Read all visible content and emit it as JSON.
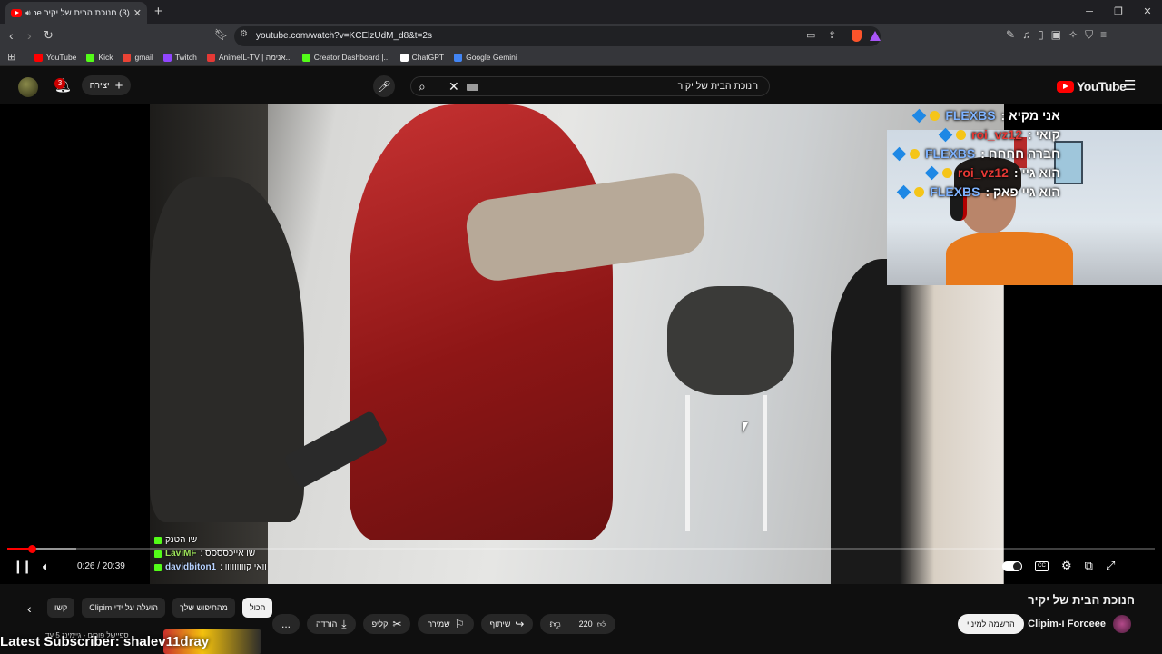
{
  "browser": {
    "tab_title": "(3) חנוכת הבית של יקיר - YouTube",
    "tab_title_short": "(3) חנוכת הבית של יקיר ube",
    "url": "youtube.com/watch?v=KCElzUdM_d8&t=2s",
    "bookmarks": [
      {
        "label": "YouTube",
        "color": "#ff0000"
      },
      {
        "label": "Kick",
        "color": "#53fc18"
      },
      {
        "label": "gmail",
        "color": "#ea4335"
      },
      {
        "label": "Twitch",
        "color": "#9146ff"
      },
      {
        "label": "AnimeIL-TV | אנימה...",
        "color": "#e53935"
      },
      {
        "label": "Creator Dashboard |...",
        "color": "#53fc18"
      },
      {
        "label": "ChatGPT",
        "color": "#ffffff"
      },
      {
        "label": "Google Gemini",
        "color": "#4285f4"
      }
    ]
  },
  "masthead": {
    "notification_count": "3",
    "create_label": "יצירה",
    "search_query": "חנוכת הבית של יקיר",
    "logo_text": "YouTube"
  },
  "overlay_chat": [
    {
      "name": "FLEXBS",
      "message": "אני מקיא",
      "name_color": "blue"
    },
    {
      "name": "roi_vz12",
      "message": "קואי",
      "name_color": "red"
    },
    {
      "name": "FLEXBS",
      "message": "חברה חחחח",
      "name_color": "blue"
    },
    {
      "name": "roi_vz12",
      "message": "הוא גיי",
      "name_color": "red"
    },
    {
      "name": "FLEXBS",
      "message": "הוא גיי פאק",
      "name_color": "blue"
    }
  ],
  "video_chat": [
    {
      "name": "",
      "message": "שו הטנק"
    },
    {
      "name": "LaviMF",
      "message": "שו אייכסססס"
    },
    {
      "name": "davidbiton1",
      "message": "וואי קווווווווו"
    }
  ],
  "player": {
    "time_display": "0:26 / 20:39",
    "current_seconds": 26,
    "duration_seconds": 1239,
    "buffered_fraction": 0.06
  },
  "video": {
    "title": "חנוכת הבית של יקיר",
    "channel": "Forceee ו-Clipim",
    "subscribe_label": "הרשמה למינוי",
    "like_count": "220",
    "share_label": "שיתוף",
    "save_label": "שמירה",
    "clip_label": "קליפ",
    "download_label": "הורדה",
    "more_label": "..."
  },
  "chips": [
    "הכול",
    "מהחיפוש שלך",
    "הועלה על ידי Clipim",
    "קשו"
  ],
  "stream_overlay": {
    "latest_subscriber": "Latest Subscriber: shalev11dray",
    "thumb_caption": "ספיישל פורים - גיימינג 5 עד"
  },
  "colors": {
    "accent": "#ff0000",
    "background": "#0f0f0f",
    "kick_green": "#53fc18"
  }
}
